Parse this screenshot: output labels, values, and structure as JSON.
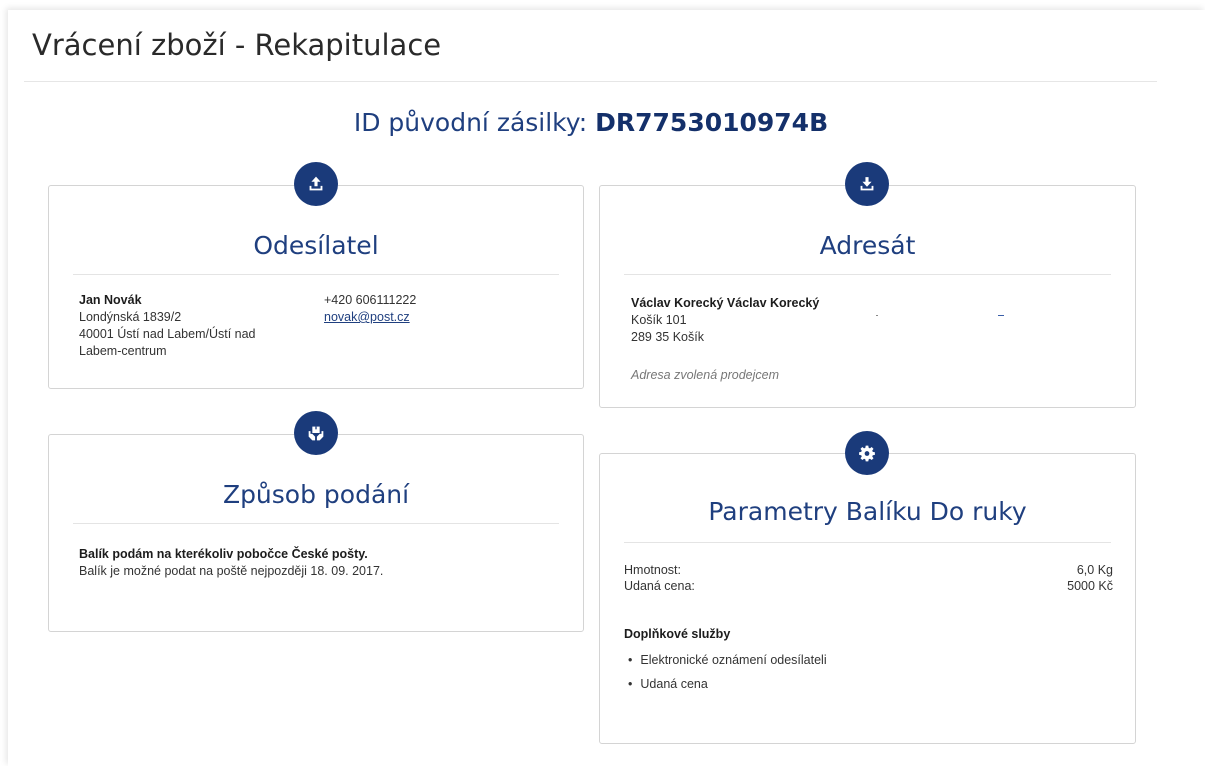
{
  "page": {
    "title": "Vrácení zboží - Rekapitulace",
    "shipment_label": "ID původní zásilky: ",
    "shipment_id": "DR7753010974B"
  },
  "sender": {
    "icon": "upload-icon",
    "title": "Odesílatel",
    "name": "Jan Novák",
    "street": "Londýnská 1839/2",
    "city_line1": "40001 Ústí nad Labem/Ústí nad",
    "city_line2": "Labem-centrum",
    "phone": "+420 606111222",
    "email": "novak@post.cz"
  },
  "recipient": {
    "icon": "download-icon",
    "title": "Adresát",
    "name": "Václav Korecký Václav Korecký",
    "street": "Košík 101",
    "city": "289 35 Košík",
    "note": "Adresa zvolená prodejcem"
  },
  "submission": {
    "icon": "hand-package-icon",
    "title": "Způsob podání",
    "headline": "Balík podám na kterékoliv pobočce České pošty.",
    "detail": "Balík je možné podat na poště nejpozději 18. 09. 2017."
  },
  "parameters": {
    "icon": "gear-icon",
    "title": "Parametry Balíku Do ruky",
    "rows": [
      {
        "label": "Hmotnost:",
        "value": "6,0 Kg"
      },
      {
        "label": "Udaná cena:",
        "value": "5000 Kč"
      }
    ],
    "services_title": "Doplňkové služby",
    "services": [
      "Elektronické oznámení odesílateli",
      "Udaná cena"
    ]
  },
  "colors": {
    "brand": "#1a3a7a",
    "heading": "#1f3f7f",
    "border": "#d4d4d4"
  }
}
